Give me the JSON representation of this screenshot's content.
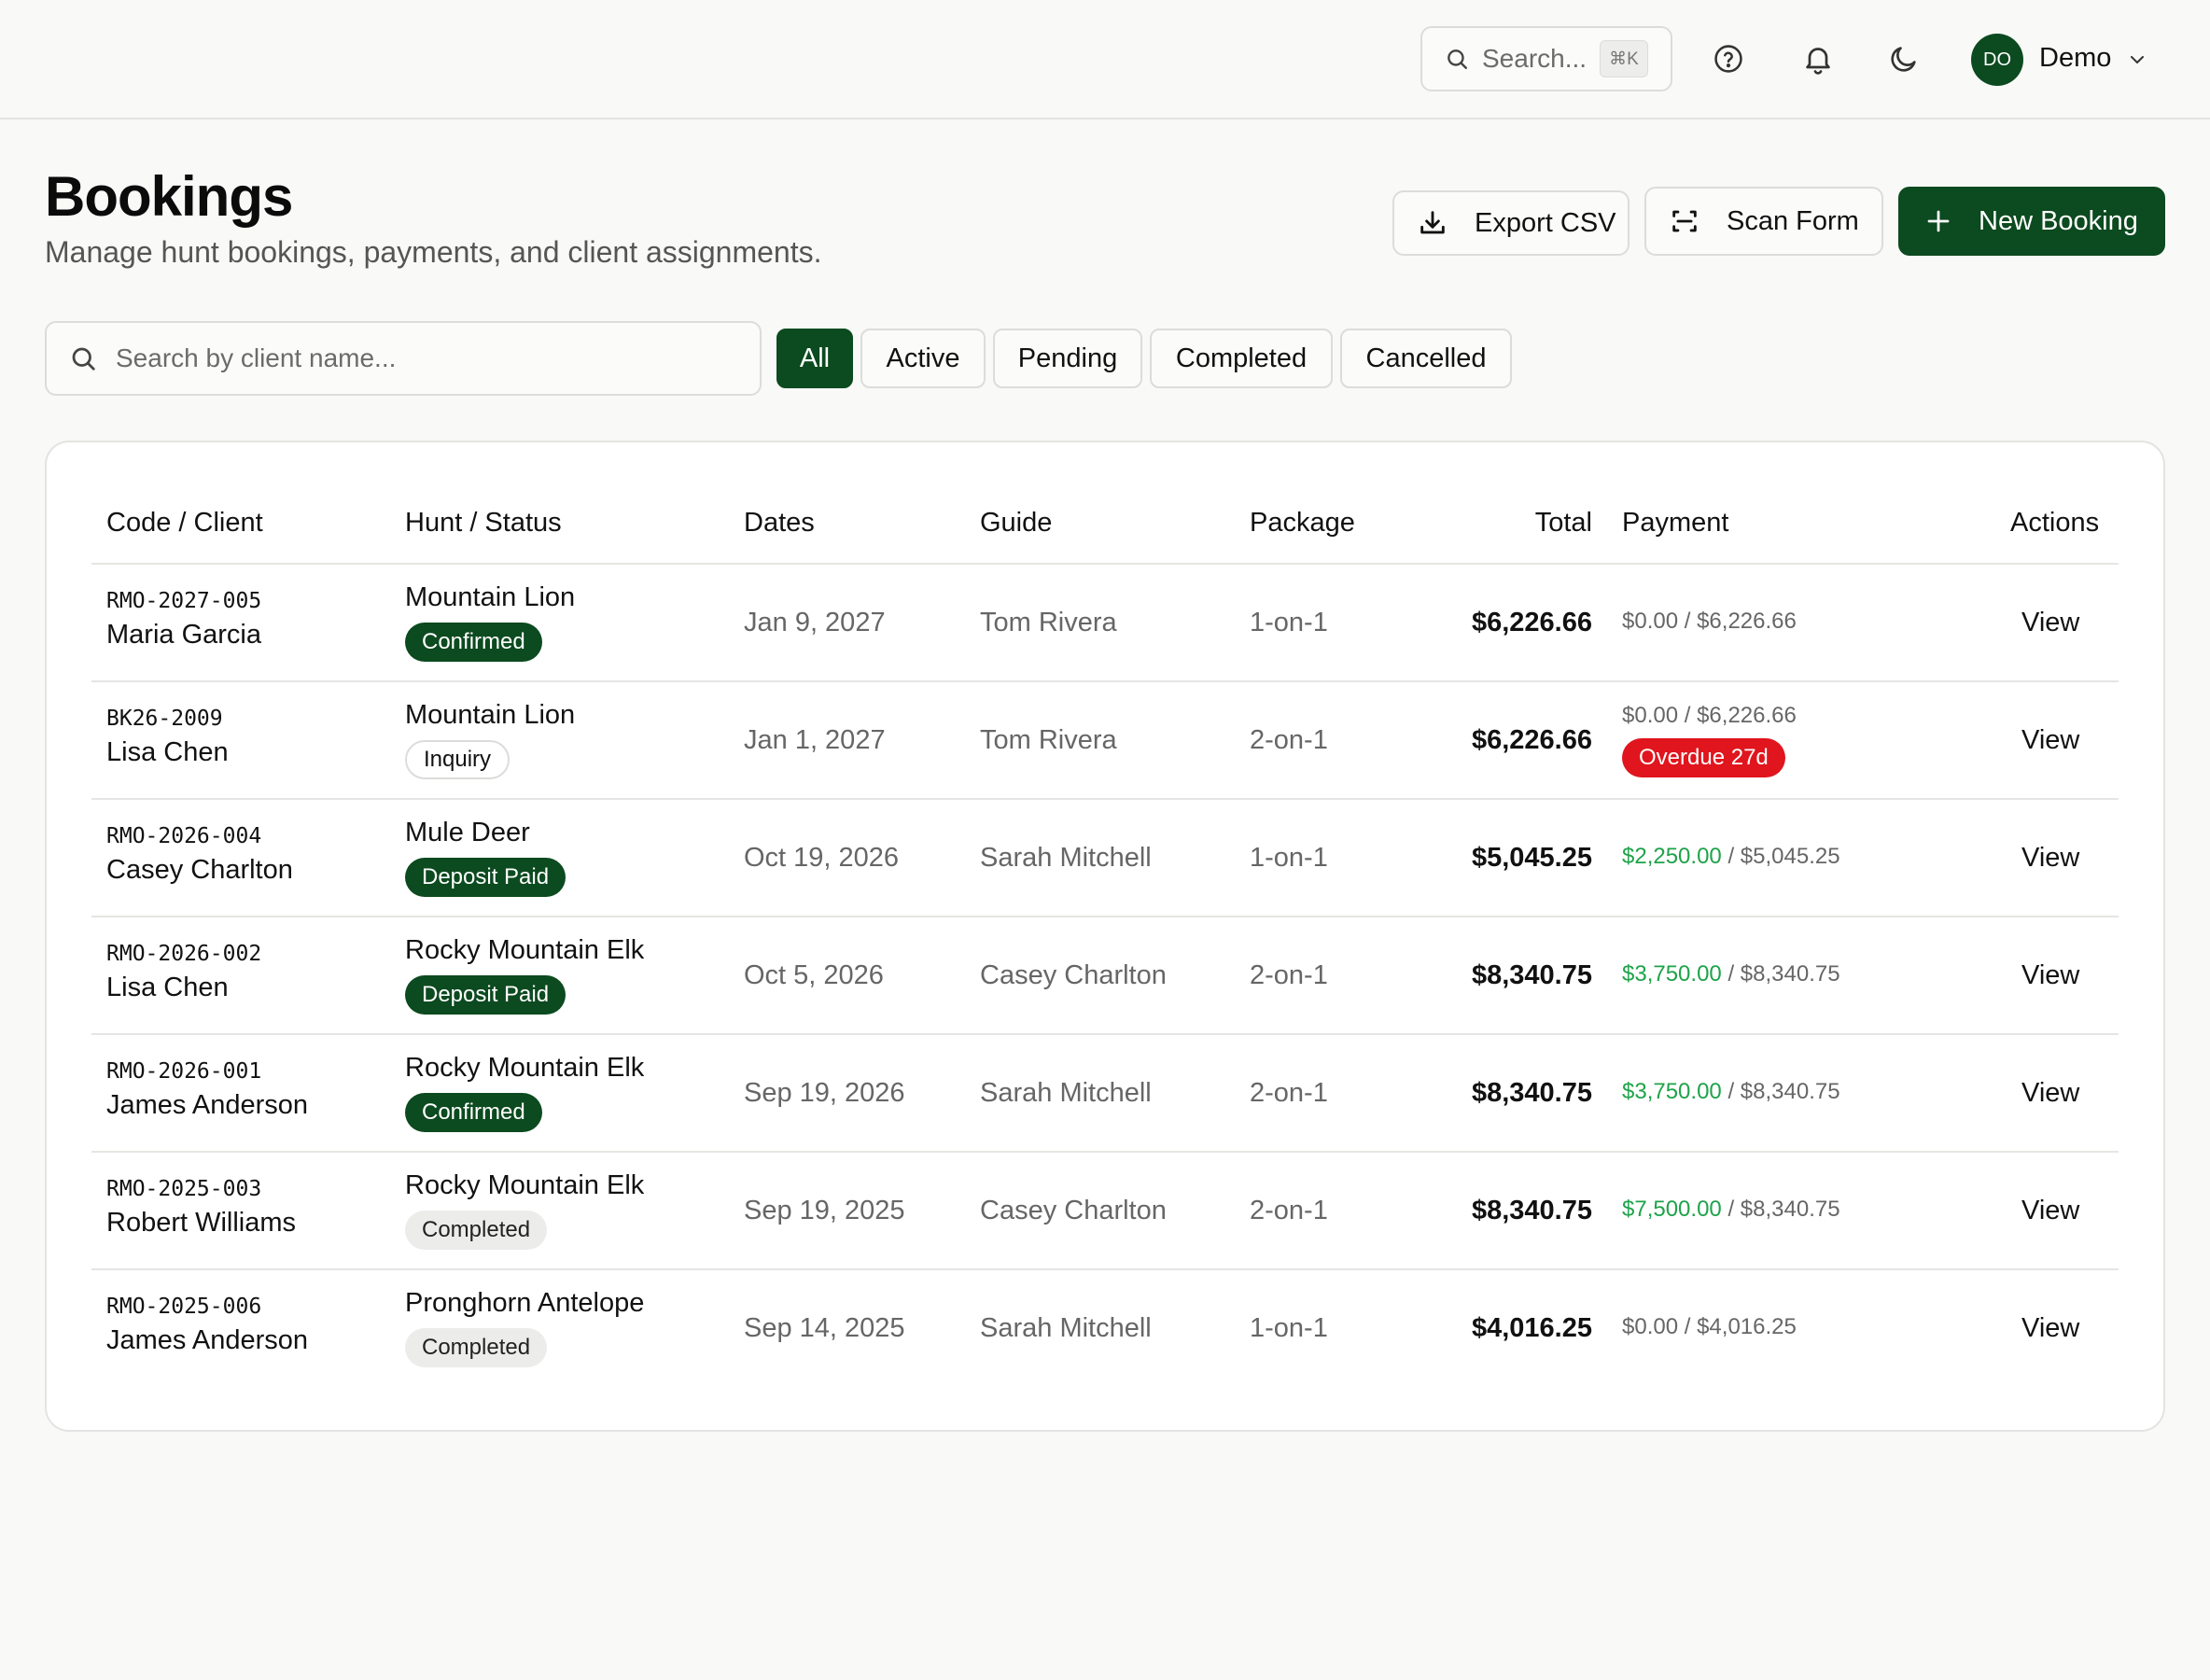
{
  "header": {
    "search_placeholder": "Search...",
    "search_shortcut": "⌘K",
    "user_initials": "DO",
    "user_name": "Demo"
  },
  "page": {
    "title": "Bookings",
    "subtitle": "Manage hunt bookings, payments, and client assignments."
  },
  "actions": {
    "export_label": "Export CSV",
    "scan_label": "Scan Form",
    "new_label": "New Booking"
  },
  "filters": {
    "search_placeholder": "Search by client name...",
    "chips": [
      "All",
      "Active",
      "Pending",
      "Completed",
      "Cancelled"
    ],
    "selected": "All"
  },
  "table": {
    "columns": [
      "Code / Client",
      "Hunt / Status",
      "Dates",
      "Guide",
      "Package",
      "Total",
      "Payment",
      "Actions"
    ],
    "rows": [
      {
        "code": "RMO-2027-005",
        "client": "Maria Garcia",
        "hunt": "Mountain Lion",
        "status": "Confirmed",
        "date": "Jan 9, 2027",
        "guide": "Tom Rivera",
        "package": "1-on-1",
        "total": "$6,226.66",
        "paid": "$0.00",
        "due": "$6,226.66",
        "paid_positive": false,
        "overdue": "",
        "action": "View"
      },
      {
        "code": "BK26-2009",
        "client": "Lisa Chen",
        "hunt": "Mountain Lion",
        "status": "Inquiry",
        "date": "Jan 1, 2027",
        "guide": "Tom Rivera",
        "package": "2-on-1",
        "total": "$6,226.66",
        "paid": "$0.00",
        "due": "$6,226.66",
        "paid_positive": false,
        "overdue": "Overdue 27d",
        "action": "View"
      },
      {
        "code": "RMO-2026-004",
        "client": "Casey Charlton",
        "hunt": "Mule Deer",
        "status": "Deposit Paid",
        "date": "Oct 19, 2026",
        "guide": "Sarah Mitchell",
        "package": "1-on-1",
        "total": "$5,045.25",
        "paid": "$2,250.00",
        "due": "$5,045.25",
        "paid_positive": true,
        "overdue": "",
        "action": "View"
      },
      {
        "code": "RMO-2026-002",
        "client": "Lisa Chen",
        "hunt": "Rocky Mountain Elk",
        "status": "Deposit Paid",
        "date": "Oct 5, 2026",
        "guide": "Casey Charlton",
        "package": "2-on-1",
        "total": "$8,340.75",
        "paid": "$3,750.00",
        "due": "$8,340.75",
        "paid_positive": true,
        "overdue": "",
        "action": "View"
      },
      {
        "code": "RMO-2026-001",
        "client": "James Anderson",
        "hunt": "Rocky Mountain Elk",
        "status": "Confirmed",
        "date": "Sep 19, 2026",
        "guide": "Sarah Mitchell",
        "package": "2-on-1",
        "total": "$8,340.75",
        "paid": "$3,750.00",
        "due": "$8,340.75",
        "paid_positive": true,
        "overdue": "",
        "action": "View"
      },
      {
        "code": "RMO-2025-003",
        "client": "Robert Williams",
        "hunt": "Rocky Mountain Elk",
        "status": "Completed",
        "date": "Sep 19, 2025",
        "guide": "Casey Charlton",
        "package": "2-on-1",
        "total": "$8,340.75",
        "paid": "$7,500.00",
        "due": "$8,340.75",
        "paid_positive": true,
        "overdue": "",
        "action": "View"
      },
      {
        "code": "RMO-2025-006",
        "client": "James Anderson",
        "hunt": "Pronghorn Antelope",
        "status": "Completed",
        "date": "Sep 14, 2025",
        "guide": "Sarah Mitchell",
        "package": "1-on-1",
        "total": "$4,016.25",
        "paid": "$0.00",
        "due": "$4,016.25",
        "paid_positive": false,
        "overdue": "",
        "action": "View"
      }
    ]
  },
  "colors": {
    "brand": "#0c4a1f",
    "paid_text": "#1ea34a",
    "overdue": "#e0151d"
  }
}
